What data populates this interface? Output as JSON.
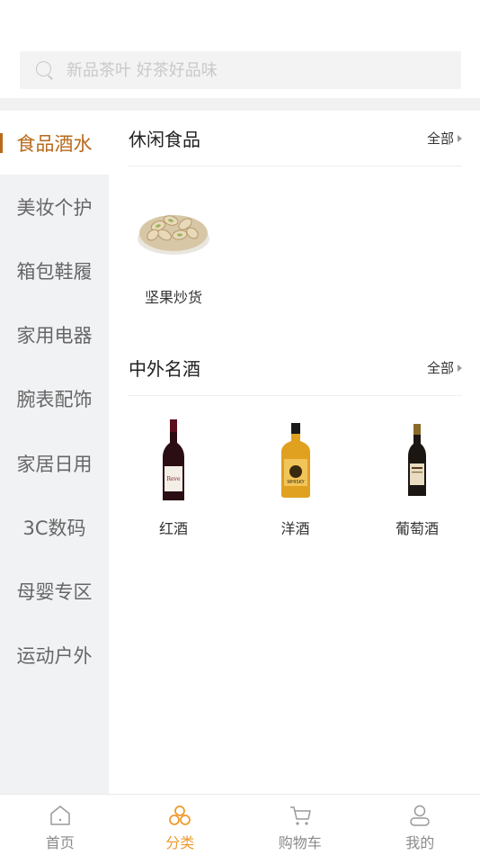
{
  "search": {
    "placeholder": "新品茶叶 好茶好品味"
  },
  "sidebar": {
    "active_index": 0,
    "items": [
      {
        "label": "食品酒水"
      },
      {
        "label": "美妆个护"
      },
      {
        "label": "箱包鞋履"
      },
      {
        "label": "家用电器"
      },
      {
        "label": "腕表配饰"
      },
      {
        "label": "家居日用"
      },
      {
        "label": "3C数码"
      },
      {
        "label": "母婴专区"
      },
      {
        "label": "运动户外"
      }
    ]
  },
  "sections": [
    {
      "title": "休闲食品",
      "see_all": "全部",
      "products": [
        {
          "name": "坚果炒货",
          "icon": "pistachio-bowl-image"
        }
      ]
    },
    {
      "title": "中外名酒",
      "see_all": "全部",
      "products": [
        {
          "name": "红酒",
          "icon": "red-wine-bottle-image"
        },
        {
          "name": "洋酒",
          "icon": "whisky-bottle-image"
        },
        {
          "name": "葡萄酒",
          "icon": "wine-bottle-image"
        }
      ]
    }
  ],
  "tabbar": {
    "active_index": 1,
    "accent_color": "#f09a2e",
    "items": [
      {
        "label": "首页",
        "icon": "home-icon"
      },
      {
        "label": "分类",
        "icon": "category-icon"
      },
      {
        "label": "购物车",
        "icon": "cart-icon"
      },
      {
        "label": "我的",
        "icon": "user-icon"
      }
    ]
  }
}
